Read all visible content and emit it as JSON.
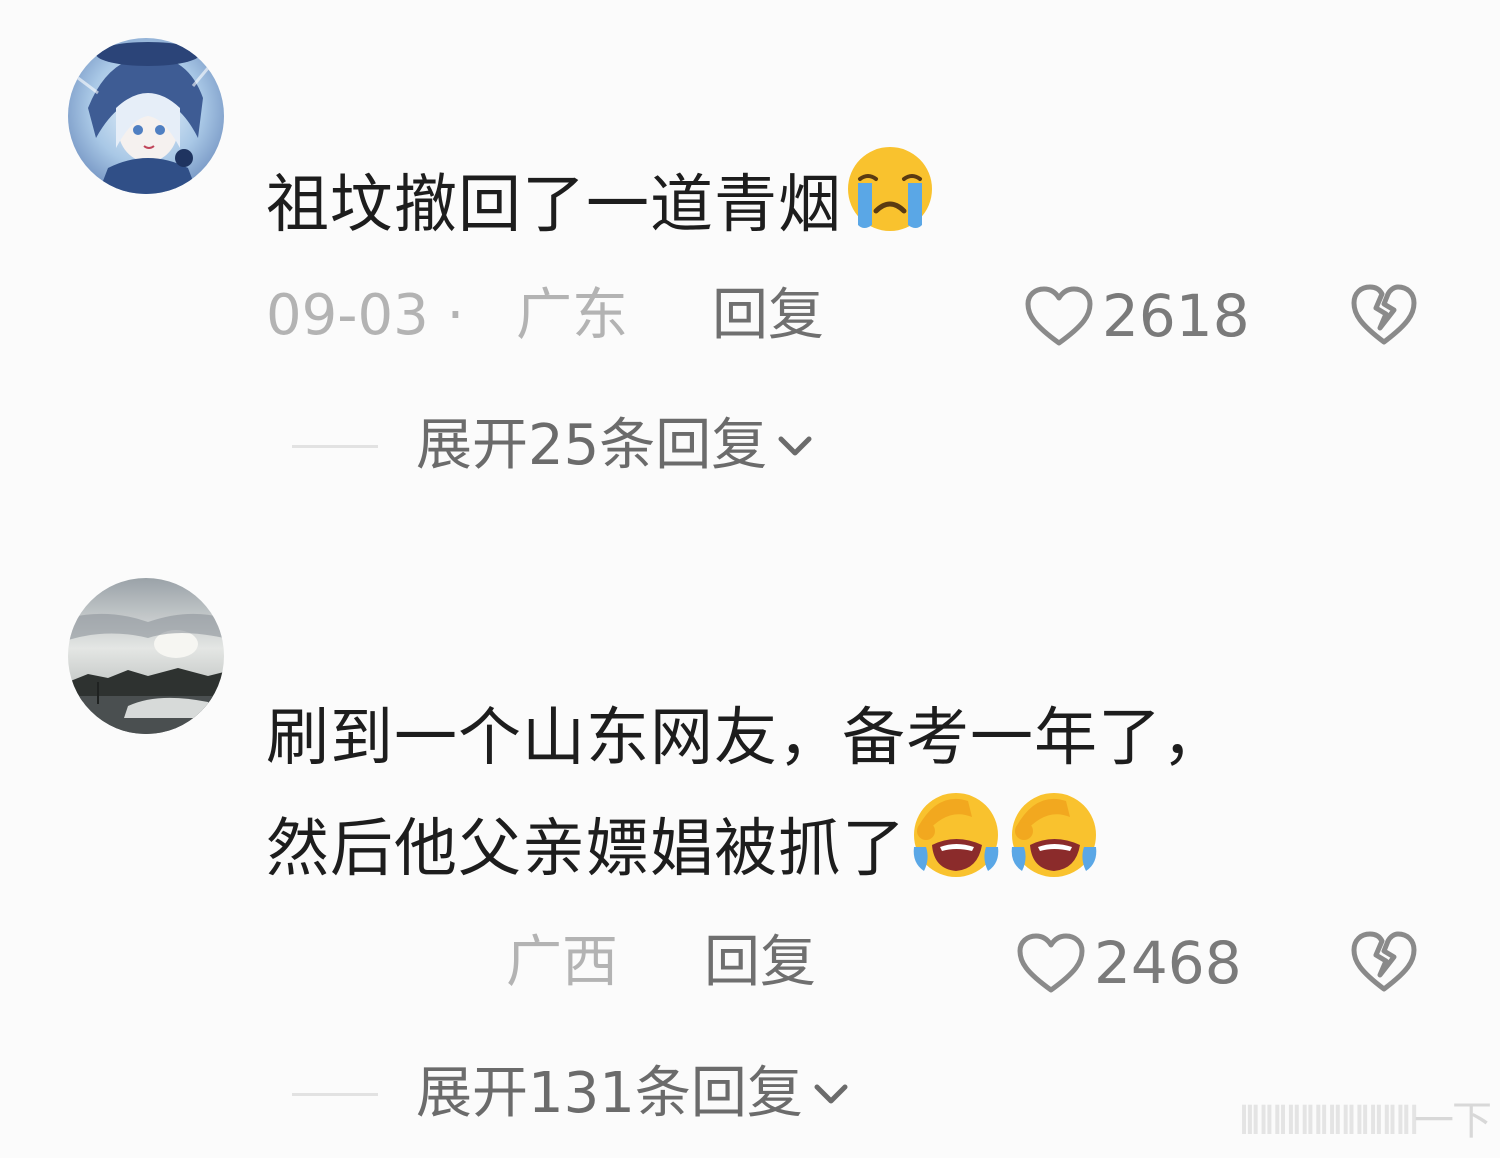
{
  "comments": [
    {
      "text": "祖坟撤回了一道青烟",
      "emojis": [
        "loudly-crying-face"
      ],
      "date": "09-03 · ",
      "location": "广东",
      "reply_label": "回复",
      "likes": "2618",
      "expand_label": "展开25条回复"
    },
    {
      "text_line1": "刷到一个山东网友，备考一年了，",
      "text_line2": "然后他父亲嫖娼被抓了",
      "emojis": [
        "face-with-tears-of-joy-cover",
        "face-with-tears-of-joy-cover"
      ],
      "location": "广西",
      "reply_label": "回复",
      "likes": "2468",
      "expand_label": "展开131条回复"
    }
  ],
  "watermark": "一下",
  "colors": {
    "background": "#fbfbfb",
    "text": "#1d1d1d",
    "meta_gray": "#b3b3b3",
    "action_gray": "#6f6f6f",
    "emoji_yellow": "#f9c22e",
    "emoji_tear_blue": "#5aa7e6"
  }
}
